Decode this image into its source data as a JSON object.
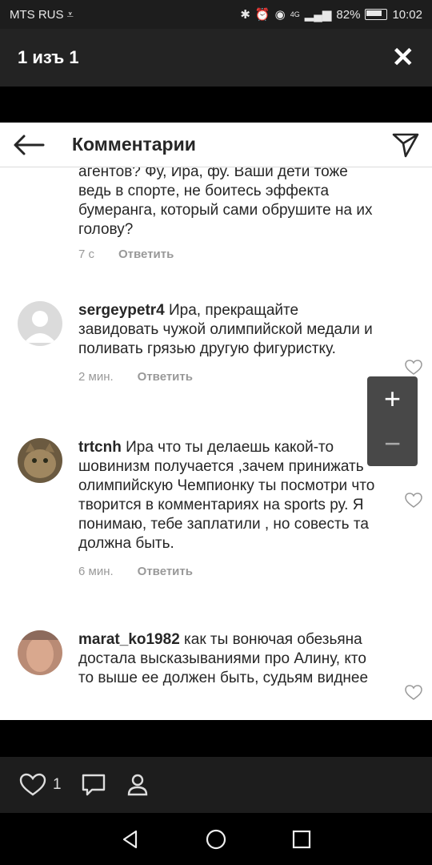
{
  "status_bar": {
    "carrier": "MTS RUS",
    "network": "4G",
    "battery": "82%",
    "time": "10:02"
  },
  "viewer": {
    "title": "1 изъ 1",
    "like_count": "1"
  },
  "header": {
    "title": "Комментарии"
  },
  "partial_comment": {
    "text": "агентов? Фу, Ира, фу. Ваши дети тоже ведь в спорте, не боитесь эффекта бумеранга, который сами обрушите на их голову?",
    "time": "7 с",
    "reply": "Ответить"
  },
  "comments": [
    {
      "username": "sergeypetr4",
      "text": "Ира, прекращайте завидовать чужой олимпийской медали и поливать грязью другую фигуристку.",
      "time": "2 мин.",
      "reply": "Ответить"
    },
    {
      "username": "trtcnh",
      "text": "Ира что ты делаешь какой-то шовинизм получается ,зачем принижать олимпийскую Чемпионку ты посмотри что творится в комментариях на sports ру. Я понимаю, тебе заплатили , но совесть та должна быть.",
      "time": "6 мин.",
      "reply": "Ответить"
    },
    {
      "username": "marat_ko1982",
      "text": "как ты вонючая обезьяна достала высказываниями про Алину, кто то выше ее должен быть, судьям виднее",
      "time": "",
      "reply": ""
    }
  ],
  "zoom": {
    "plus": "+",
    "minus": "−"
  },
  "icons": {
    "status": [
      "download-icon",
      "bluetooth-icon",
      "alarm-icon",
      "eye-icon",
      "signal-icon",
      "battery-icon"
    ],
    "header": [
      "back-arrow-icon",
      "direct-send-icon"
    ],
    "bottom": [
      "heart-icon",
      "comment-icon",
      "person-icon"
    ],
    "nav": [
      "nav-back-icon",
      "nav-home-icon",
      "nav-recents-icon"
    ]
  }
}
